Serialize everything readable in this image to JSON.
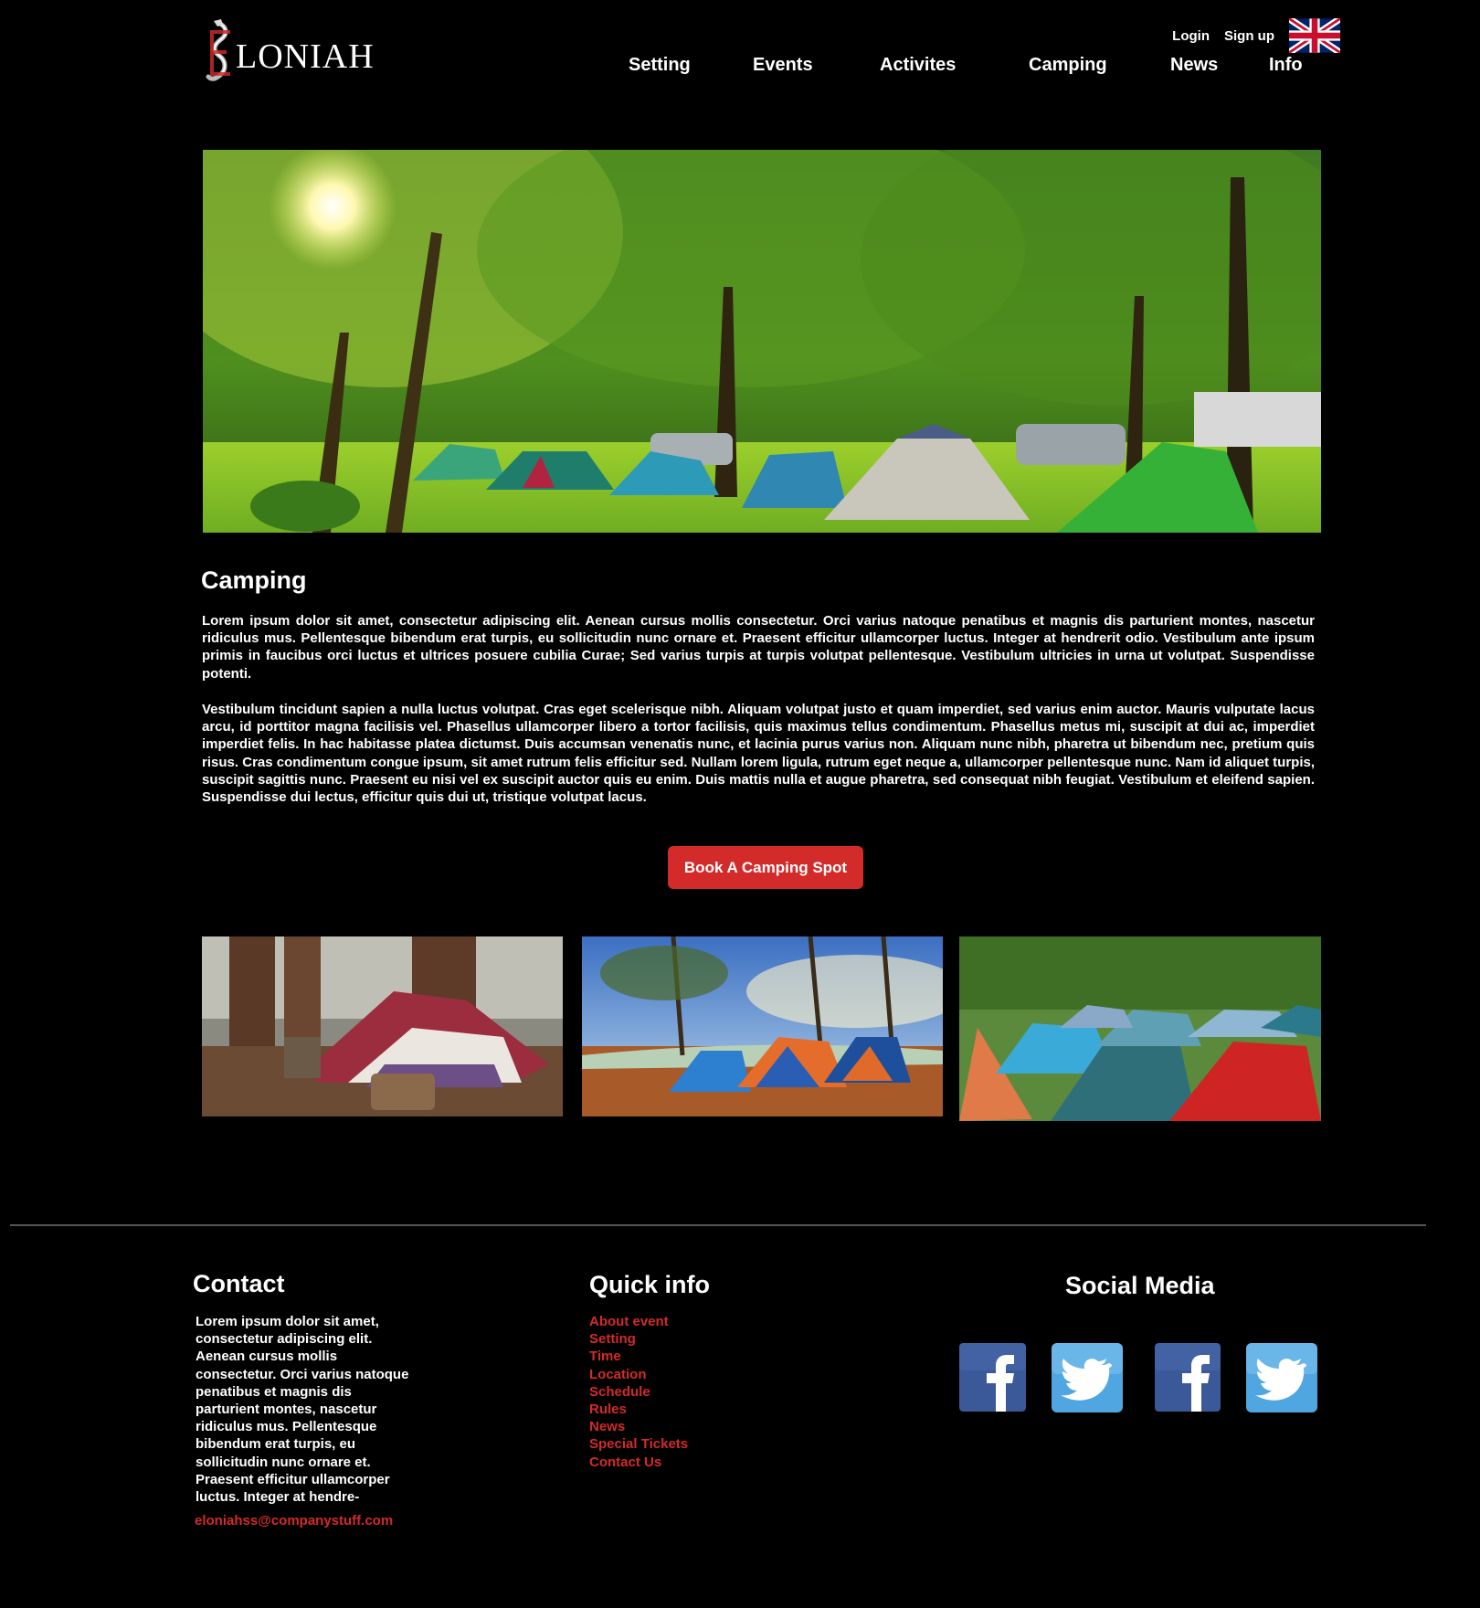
{
  "header": {
    "logo_text": "LONIAH",
    "login_label": "Login",
    "signup_label": "Sign up"
  },
  "nav": {
    "items": [
      {
        "label": "Setting"
      },
      {
        "label": "Events"
      },
      {
        "label": "Activites"
      },
      {
        "label": "Camping"
      },
      {
        "label": "News"
      },
      {
        "label": "Info"
      }
    ]
  },
  "main": {
    "title": "Camping",
    "paragraph1": "Lorem ipsum dolor sit amet, consectetur adipiscing elit. Aenean cursus mollis consectetur. Orci varius natoque penatibus et magnis dis parturient montes, nascetur ridiculus mus. Pellentesque bibendum erat turpis, eu sollicitudin nunc ornare et. Praesent efficitur ullamcorper luctus. Integer at hendrerit odio. Vestibulum ante ipsum primis in faucibus orci luctus et ultrices posuere cubilia Curae; Sed varius turpis at turpis volutpat pellentesque. Vestibulum ultricies in urna ut volutpat. Suspendisse potenti.",
    "paragraph2": "Vestibulum tincidunt sapien a nulla luctus volutpat. Cras eget scelerisque nibh. Aliquam volutpat justo et quam imperdiet, sed varius enim auctor. Mauris vulputate lacus arcu, id porttitor magna facilisis vel. Phasellus ullamcorper libero a tortor facilisis, quis maximus tellus condimentum. Phasellus metus mi, suscipit at dui ac, imperdiet imperdiet felis. In hac habitasse platea dictumst. Duis accumsan venenatis nunc, et lacinia purus varius non. Aliquam nunc nibh, pharetra ut bibendum nec, pretium quis risus. Cras condimentum congue ipsum, sit amet rutrum felis efficitur sed. Nullam lorem ligula, rutrum eget neque a, ullamcorper pellentesque nunc. Nam id aliquet turpis, suscipit sagittis nunc. Praesent eu nisi vel ex suscipit auctor quis eu enim. Duis mattis nulla et augue pharetra, sed consequat nibh feugiat. Vestibulum et eleifend sapien. Suspendisse dui lectus, efficitur quis dui ut, tristique volutpat lacus.",
    "book_button": "Book A Camping Spot"
  },
  "footer": {
    "contact": {
      "heading": "Contact",
      "text": "Lorem ipsum dolor sit amet, consectetur adipiscing elit. Aenean cursus mollis consectetur. Orci varius natoque penatibus et magnis dis parturient montes, nascetur ridiculus mus. Pellentesque bibendum erat turpis, eu sollicitudin nunc ornare et. Praesent efficitur ullamcorper luctus. Integer at hendre-",
      "email": "eloniahss@companystuff.com"
    },
    "quick_info": {
      "heading": "Quick info",
      "items": [
        "About event",
        "Setting",
        "Time",
        "Location",
        "Schedule",
        "Rules",
        "News",
        "Special Tickets",
        "Contact Us"
      ]
    },
    "social": {
      "heading": "Social Media"
    }
  },
  "colors": {
    "background": "#000000",
    "accent": "#d32a2a",
    "text": "#ffffff"
  },
  "icons": [
    "dragon-logo-icon",
    "uk-flag-icon",
    "facebook-icon",
    "twitter-icon"
  ]
}
